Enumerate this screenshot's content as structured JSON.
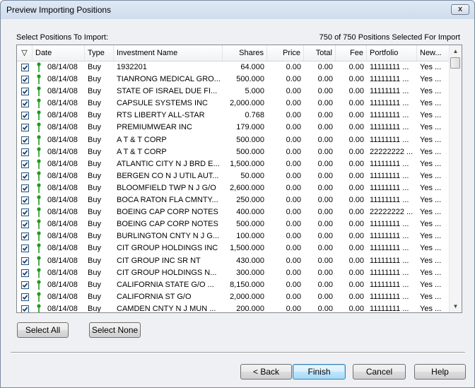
{
  "window": {
    "title": "Preview Importing Positions",
    "close_glyph": "x"
  },
  "labels": {
    "select_prompt": "Select Positions To Import:",
    "selected_count": "750 of 750 Positions Selected For Import"
  },
  "grid": {
    "sort_glyph": "▽",
    "columns": [
      "Date",
      "Type",
      "Investment Name",
      "Shares",
      "Price",
      "Total",
      "Fee",
      "Portfolio",
      "New..."
    ],
    "rows": [
      {
        "date": "08/14/08",
        "type": "Buy",
        "name": "1932201",
        "shares": "64.000",
        "price": "0.00",
        "total": "0.00",
        "fee": "0.00",
        "portfolio": "11111111 ...",
        "new": "Yes ..."
      },
      {
        "date": "08/14/08",
        "type": "Buy",
        "name": "TIANRONG MEDICAL GRO...",
        "shares": "500.000",
        "price": "0.00",
        "total": "0.00",
        "fee": "0.00",
        "portfolio": "11111111 ...",
        "new": "Yes ..."
      },
      {
        "date": "08/14/08",
        "type": "Buy",
        "name": "STATE OF ISRAEL DUE FI...",
        "shares": "5.000",
        "price": "0.00",
        "total": "0.00",
        "fee": "0.00",
        "portfolio": "11111111 ...",
        "new": "Yes ..."
      },
      {
        "date": "08/14/08",
        "type": "Buy",
        "name": "CAPSULE SYSTEMS INC",
        "shares": "2,000.000",
        "price": "0.00",
        "total": "0.00",
        "fee": "0.00",
        "portfolio": "11111111 ...",
        "new": "Yes ..."
      },
      {
        "date": "08/14/08",
        "type": "Buy",
        "name": "RTS LIBERTY ALL-STAR",
        "shares": "0.768",
        "price": "0.00",
        "total": "0.00",
        "fee": "0.00",
        "portfolio": "11111111 ...",
        "new": "Yes ..."
      },
      {
        "date": "08/14/08",
        "type": "Buy",
        "name": "PREMIUMWEAR INC",
        "shares": "179.000",
        "price": "0.00",
        "total": "0.00",
        "fee": "0.00",
        "portfolio": "11111111 ...",
        "new": "Yes ..."
      },
      {
        "date": "08/14/08",
        "type": "Buy",
        "name": "A T & T CORP",
        "shares": "500.000",
        "price": "0.00",
        "total": "0.00",
        "fee": "0.00",
        "portfolio": "11111111 ...",
        "new": "Yes ..."
      },
      {
        "date": "08/14/08",
        "type": "Buy",
        "name": "A T & T CORP",
        "shares": "500.000",
        "price": "0.00",
        "total": "0.00",
        "fee": "0.00",
        "portfolio": "22222222 ...",
        "new": "Yes ..."
      },
      {
        "date": "08/14/08",
        "type": "Buy",
        "name": "ATLANTIC CITY N J BRD E...",
        "shares": "1,500.000",
        "price": "0.00",
        "total": "0.00",
        "fee": "0.00",
        "portfolio": "11111111 ...",
        "new": "Yes ..."
      },
      {
        "date": "08/14/08",
        "type": "Buy",
        "name": "BERGEN CO N J UTIL AUT...",
        "shares": "50.000",
        "price": "0.00",
        "total": "0.00",
        "fee": "0.00",
        "portfolio": "11111111 ...",
        "new": "Yes ..."
      },
      {
        "date": "08/14/08",
        "type": "Buy",
        "name": "BLOOMFIELD TWP N J G/O",
        "shares": "2,600.000",
        "price": "0.00",
        "total": "0.00",
        "fee": "0.00",
        "portfolio": "11111111 ...",
        "new": "Yes ..."
      },
      {
        "date": "08/14/08",
        "type": "Buy",
        "name": "BOCA RATON FLA CMNTY...",
        "shares": "250.000",
        "price": "0.00",
        "total": "0.00",
        "fee": "0.00",
        "portfolio": "11111111 ...",
        "new": "Yes ..."
      },
      {
        "date": "08/14/08",
        "type": "Buy",
        "name": "BOEING CAP CORP NOTES",
        "shares": "400.000",
        "price": "0.00",
        "total": "0.00",
        "fee": "0.00",
        "portfolio": "22222222 ...",
        "new": "Yes ..."
      },
      {
        "date": "08/14/08",
        "type": "Buy",
        "name": "BOEING CAP CORP NOTES",
        "shares": "500.000",
        "price": "0.00",
        "total": "0.00",
        "fee": "0.00",
        "portfolio": "11111111 ...",
        "new": "Yes ..."
      },
      {
        "date": "08/14/08",
        "type": "Buy",
        "name": "BURLINGTON CNTY N J G...",
        "shares": "100.000",
        "price": "0.00",
        "total": "0.00",
        "fee": "0.00",
        "portfolio": "11111111 ...",
        "new": "Yes ..."
      },
      {
        "date": "08/14/08",
        "type": "Buy",
        "name": "CIT GROUP HOLDINGS INC",
        "shares": "1,500.000",
        "price": "0.00",
        "total": "0.00",
        "fee": "0.00",
        "portfolio": "11111111 ...",
        "new": "Yes ..."
      },
      {
        "date": "08/14/08",
        "type": "Buy",
        "name": "CIT GROUP INC SR NT",
        "shares": "430.000",
        "price": "0.00",
        "total": "0.00",
        "fee": "0.00",
        "portfolio": "11111111 ...",
        "new": "Yes ..."
      },
      {
        "date": "08/14/08",
        "type": "Buy",
        "name": "CIT GROUP HOLDINGS N...",
        "shares": "300.000",
        "price": "0.00",
        "total": "0.00",
        "fee": "0.00",
        "portfolio": "11111111 ...",
        "new": "Yes ..."
      },
      {
        "date": "08/14/08",
        "type": "Buy",
        "name": "CALIFORNIA STATE G/O ...",
        "shares": "8,150.000",
        "price": "0.00",
        "total": "0.00",
        "fee": "0.00",
        "portfolio": "11111111 ...",
        "new": "Yes ..."
      },
      {
        "date": "08/14/08",
        "type": "Buy",
        "name": "CALIFORNIA ST G/O",
        "shares": "2,000.000",
        "price": "0.00",
        "total": "0.00",
        "fee": "0.00",
        "portfolio": "11111111 ...",
        "new": "Yes ..."
      },
      {
        "date": "08/14/08",
        "type": "Buy",
        "name": "CAMDEN CNTY N J MUN ...",
        "shares": "200.000",
        "price": "0.00",
        "total": "0.00",
        "fee": "0.00",
        "portfolio": "11111111 ...",
        "new": "Yes ..."
      }
    ]
  },
  "buttons": {
    "select_all": "Select All",
    "select_none": "Select None",
    "back": "< Back",
    "finish": "Finish",
    "cancel": "Cancel",
    "help": "Help"
  },
  "icons": {
    "checkbox": "checkbox-checked-icon",
    "status": "green-pin-icon",
    "scroll_up": "▲",
    "scroll_down": "▼"
  },
  "colors": {
    "pin_green": "#1e9b1e",
    "check_mark": "#1c3d6e",
    "default_button_border": "#3c7fb1"
  }
}
